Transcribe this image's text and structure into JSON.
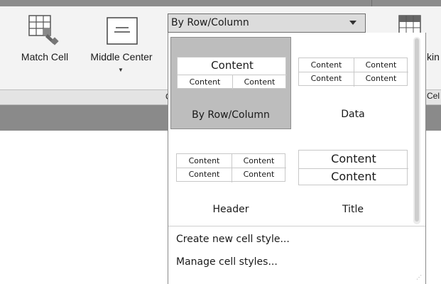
{
  "ribbon": {
    "tools": [
      {
        "label": "Match Cell",
        "icon": "match-cell-icon"
      },
      {
        "label": "Middle Center",
        "icon": "middle-center-icon"
      }
    ],
    "panel_title_fragment": "C",
    "right_partial_label": "kin",
    "right_partial_panel": "Cel"
  },
  "cell_style": {
    "selected": "By Row/Column",
    "options": [
      {
        "caption": "By Row/Column",
        "selected": true,
        "preview": {
          "title": "Content",
          "cells": [
            "Content",
            "Content"
          ]
        }
      },
      {
        "caption": "Data",
        "selected": false,
        "preview": {
          "cells": [
            "Content",
            "Content",
            "Content",
            "Content"
          ]
        }
      },
      {
        "caption": "Header",
        "selected": false,
        "preview": {
          "cells": [
            "Content",
            "Content",
            "Content",
            "Content"
          ]
        }
      },
      {
        "caption": "Title",
        "selected": false,
        "preview": {
          "rows": [
            "Content",
            "Content"
          ]
        }
      }
    ]
  },
  "menu": {
    "create": "Create new cell style...",
    "manage": "Manage cell styles..."
  }
}
